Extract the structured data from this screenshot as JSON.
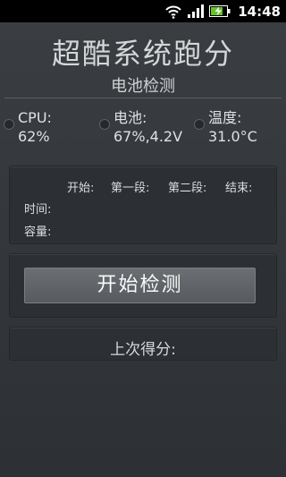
{
  "status_bar": {
    "time": "14:48"
  },
  "header": {
    "title": "超酷系统跑分",
    "subtitle": "电池检测"
  },
  "stats": [
    {
      "label": "CPU:",
      "value": "62%"
    },
    {
      "label": "电池:",
      "value": "67%,4.2V"
    },
    {
      "label": "温度:",
      "value": "31.0°C"
    }
  ],
  "table": {
    "columns": [
      "开始:",
      "第一段:",
      "第二段:",
      "结束:"
    ],
    "rows": [
      "时间:",
      "容量:"
    ]
  },
  "actions": {
    "start_label": "开始检测"
  },
  "score": {
    "last_label": "上次得分:"
  },
  "colors": {
    "background": "#2f3236",
    "button": "#62666a",
    "text": "#d8dadb"
  }
}
